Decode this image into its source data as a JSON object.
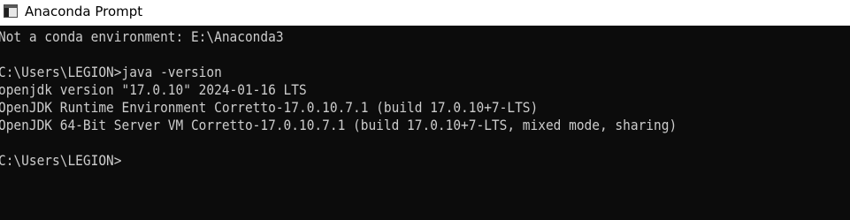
{
  "window": {
    "title": "Anaconda Prompt",
    "icon": "console-window-icon"
  },
  "console": {
    "lines": [
      "Not a conda environment: E:\\Anaconda3",
      "",
      "C:\\Users\\LEGION>java -version",
      "openjdk version \"17.0.10\" 2024-01-16 LTS",
      "OpenJDK Runtime Environment Corretto-17.0.10.7.1 (build 17.0.10+7-LTS)",
      "OpenJDK 64-Bit Server VM Corretto-17.0.10.7.1 (build 17.0.10+7-LTS, mixed mode, sharing)",
      "",
      "C:\\Users\\LEGION>"
    ]
  },
  "colors": {
    "console_background": "#0c0c0c",
    "console_text": "#cccccc",
    "titlebar_background": "#ffffff"
  }
}
